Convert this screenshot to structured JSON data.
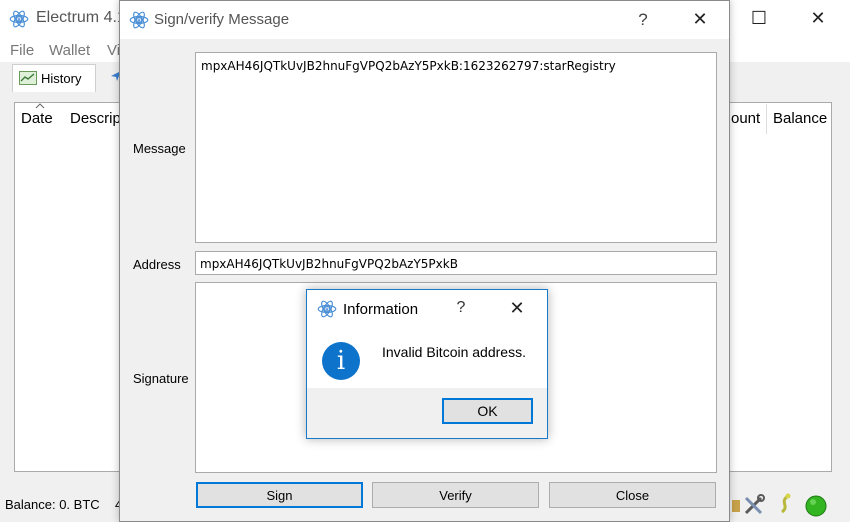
{
  "main": {
    "title": "Electrum 4.1.",
    "menu": [
      "File",
      "Wallet",
      "Vi"
    ],
    "tab_history": "History",
    "columns": {
      "date": "Date",
      "description": "Descrip",
      "amount": "ount",
      "balance": "Balance"
    },
    "balance": "Balance: 0. BTC",
    "status_partial": "4"
  },
  "signverify": {
    "title": "Sign/verify Message",
    "help_glyph": "?",
    "close_glyph": "✕",
    "message_label": "Message",
    "message_value": "mpxAH46JQTkUvJB2hnuFgVPQ2bAzY5PxkB:1623262797:starRegistry",
    "address_label": "Address",
    "address_value": "mpxAH46JQTkUvJB2hnuFgVPQ2bAzY5PxkB",
    "signature_label": "Signature",
    "signature_value": "",
    "buttons": {
      "sign": "Sign",
      "verify": "Verify",
      "close": "Close"
    }
  },
  "info": {
    "title": "Information",
    "help_glyph": "?",
    "close_glyph": "✕",
    "icon_glyph": "i",
    "message": "Invalid Bitcoin address.",
    "ok": "OK"
  },
  "window_controls": {
    "minimize": "—",
    "maximize": "☐",
    "close": "✕"
  },
  "colors": {
    "accent": "#0078d7",
    "info_icon": "#0d73cb",
    "status_green": "#33b521",
    "electrum_blue": "#4b8fd6"
  }
}
